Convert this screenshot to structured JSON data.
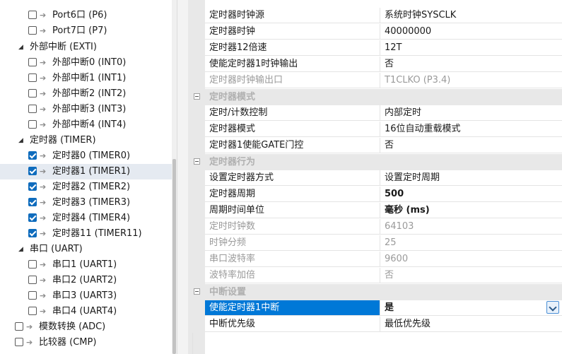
{
  "tree": {
    "items": [
      {
        "label": "Port6口 (P6)",
        "checked": false
      },
      {
        "label": "Port7口 (P7)",
        "checked": false
      },
      {
        "label": "外部中断 (EXTI)"
      },
      {
        "label": "外部中断0 (INT0)",
        "checked": false
      },
      {
        "label": "外部中断1 (INT1)",
        "checked": false
      },
      {
        "label": "外部中断2 (INT2)",
        "checked": false
      },
      {
        "label": "外部中断3 (INT3)",
        "checked": false
      },
      {
        "label": "外部中断4 (INT4)",
        "checked": false
      },
      {
        "label": "定时器 (TIMER)"
      },
      {
        "label": "定时器0 (TIMER0)",
        "checked": true
      },
      {
        "label": "定时器1 (TIMER1)",
        "checked": true
      },
      {
        "label": "定时器2 (TIMER2)",
        "checked": true
      },
      {
        "label": "定时器3 (TIMER3)",
        "checked": true
      },
      {
        "label": "定时器4 (TIMER4)",
        "checked": true
      },
      {
        "label": "定时器11 (TIMER11)",
        "checked": true
      },
      {
        "label": "串口 (UART)"
      },
      {
        "label": "串口1 (UART1)",
        "checked": false
      },
      {
        "label": "串口2 (UART2)",
        "checked": false
      },
      {
        "label": "串口3 (UART3)",
        "checked": false
      },
      {
        "label": "串口4 (UART4)",
        "checked": false
      },
      {
        "label": "模数转换 (ADC)",
        "checked": false
      },
      {
        "label": "比较器 (CMP)",
        "checked": false
      }
    ]
  },
  "grid": {
    "rows": [
      {
        "name": "定时器时钟源",
        "value": "系统时钟SYSCLK"
      },
      {
        "name": "定时器时钟",
        "value": "40000000"
      },
      {
        "name": "定时器12倍速",
        "value": "12T"
      },
      {
        "name": "使能定时器1时钟输出",
        "value": "否"
      },
      {
        "name": "定时器时钟输出口",
        "value": "T1CLKO (P3.4)"
      }
    ],
    "cat_mode": "定时器模式",
    "rows_mode": [
      {
        "name": "定时/计数控制",
        "value": "内部定时"
      },
      {
        "name": "定时器模式",
        "value": "16位自动重载模式"
      },
      {
        "name": "定时器1使能GATE门控",
        "value": "否"
      }
    ],
    "cat_behavior": "定时器行为",
    "rows_behavior": [
      {
        "name": "设置定时器方式",
        "value": "设置定时周期"
      },
      {
        "name": "定时器周期",
        "value": "500"
      },
      {
        "name": "周期时间单位",
        "value": "毫秒 (ms)"
      },
      {
        "name": "定时时钟数",
        "value": "64103"
      },
      {
        "name": "时钟分频",
        "value": "25"
      },
      {
        "name": "串口波特率",
        "value": "9600"
      },
      {
        "name": "波特率加倍",
        "value": "否"
      }
    ],
    "cat_interrupt": "中断设置",
    "rows_interrupt": [
      {
        "name": "使能定时器1中断",
        "value": "是"
      },
      {
        "name": "中断优先级",
        "value": "最低优先级"
      }
    ]
  }
}
